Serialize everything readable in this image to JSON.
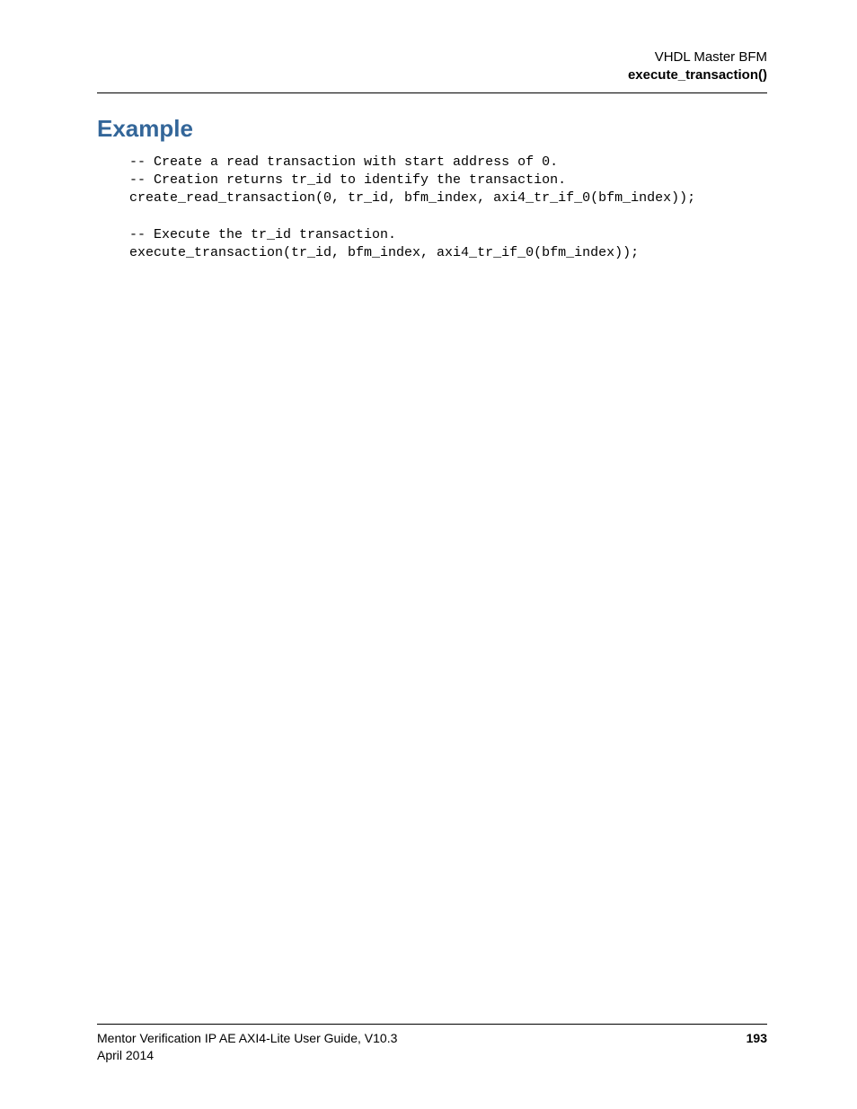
{
  "header": {
    "line1": "VHDL Master BFM",
    "line2": "execute_transaction()"
  },
  "section": {
    "heading": "Example",
    "code": "-- Create a read transaction with start address of 0.\n-- Creation returns tr_id to identify the transaction.\ncreate_read_transaction(0, tr_id, bfm_index, axi4_tr_if_0(bfm_index));\n\n-- Execute the tr_id transaction.\nexecute_transaction(tr_id, bfm_index, axi4_tr_if_0(bfm_index));"
  },
  "footer": {
    "guide": "Mentor Verification IP AE AXI4-Lite User Guide, V10.3",
    "date": "April 2014",
    "page": "193"
  }
}
